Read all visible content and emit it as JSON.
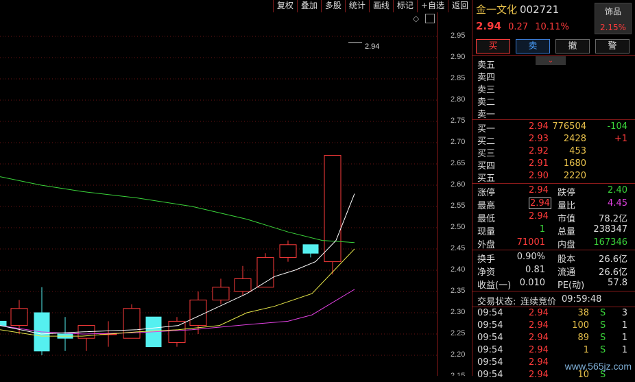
{
  "toolbar": [
    "复权",
    "叠加",
    "多股",
    "统计",
    "画线",
    "标记",
    "+自选",
    "返回"
  ],
  "y_axis_ticks": [
    "2.95",
    "2.90",
    "2.85",
    "2.80",
    "2.75",
    "2.70",
    "2.65",
    "2.60",
    "2.55",
    "2.50",
    "2.45",
    "2.40",
    "2.35",
    "2.30",
    "2.25",
    "2.20",
    "2.15"
  ],
  "chart_annotation": "2.94",
  "stock": {
    "name": "金一文化",
    "code": "002721",
    "price": "2.94",
    "change": "0.27",
    "change_pct": "10.11%"
  },
  "sector": {
    "name": "饰品",
    "pct": "2.15%"
  },
  "buttons": {
    "buy": "买",
    "sell": "卖",
    "cancel": "撤",
    "alert": "警"
  },
  "asks": [
    {
      "label": "卖五"
    },
    {
      "label": "卖四"
    },
    {
      "label": "卖三"
    },
    {
      "label": "卖二"
    },
    {
      "label": "卖一"
    }
  ],
  "bids": [
    {
      "label": "买一",
      "price": "2.94",
      "vol": "776504",
      "chg": "-104"
    },
    {
      "label": "买二",
      "price": "2.93",
      "vol": "2428",
      "chg": "+1"
    },
    {
      "label": "买三",
      "price": "2.92",
      "vol": "453",
      "chg": ""
    },
    {
      "label": "买四",
      "price": "2.91",
      "vol": "1680",
      "chg": ""
    },
    {
      "label": "买五",
      "price": "2.90",
      "vol": "2220",
      "chg": ""
    }
  ],
  "stats1": {
    "limit_up_label": "涨停",
    "limit_up": "2.94",
    "limit_down_label": "跌停",
    "limit_down": "2.40",
    "high_label": "最高",
    "high": "2.94",
    "vol_ratio_label": "量比",
    "vol_ratio": "4.45",
    "low_label": "最低",
    "low": "2.94",
    "mkt_cap_label": "市值",
    "mkt_cap": "78.2亿",
    "cur_vol_label": "现量",
    "cur_vol": "1",
    "total_vol_label": "总量",
    "total_vol": "238347",
    "outer_label": "外盘",
    "outer": "71001",
    "inner_label": "内盘",
    "inner": "167346"
  },
  "stats2": {
    "turnover_label": "换手",
    "turnover": "0.90%",
    "share_cap_label": "股本",
    "share_cap": "26.6亿",
    "nav_label": "净资",
    "nav": "0.81",
    "float_label": "流通",
    "float": "26.6亿",
    "eps_label": "收益(一)",
    "eps": "0.010",
    "pe_label": "PE(动)",
    "pe": "57.8"
  },
  "trade_status": {
    "label": "交易状态:",
    "value": "连续竞价",
    "time": "09:59:48"
  },
  "ticks": [
    {
      "time": "09:54",
      "price": "2.94",
      "vol": "38",
      "side": "S",
      "n": "3"
    },
    {
      "time": "09:54",
      "price": "2.94",
      "vol": "100",
      "side": "S",
      "n": "1"
    },
    {
      "time": "09:54",
      "price": "2.94",
      "vol": "89",
      "side": "S",
      "n": "1"
    },
    {
      "time": "09:54",
      "price": "2.94",
      "vol": "1",
      "side": "S",
      "n": "1"
    },
    {
      "time": "09:54",
      "price": "2.94",
      "vol": "",
      "side": "",
      "n": ""
    },
    {
      "time": "09:54",
      "price": "2.94",
      "vol": "10",
      "side": "S",
      "n": ""
    }
  ],
  "watermark": "www.565jz.com",
  "colors": {
    "up": "#ff3b3b",
    "down": "#55f0f0",
    "ma5": "#ffffff",
    "ma10": "#e8e84a",
    "ma20": "#e040e0",
    "ma60": "#3ad33a"
  }
}
